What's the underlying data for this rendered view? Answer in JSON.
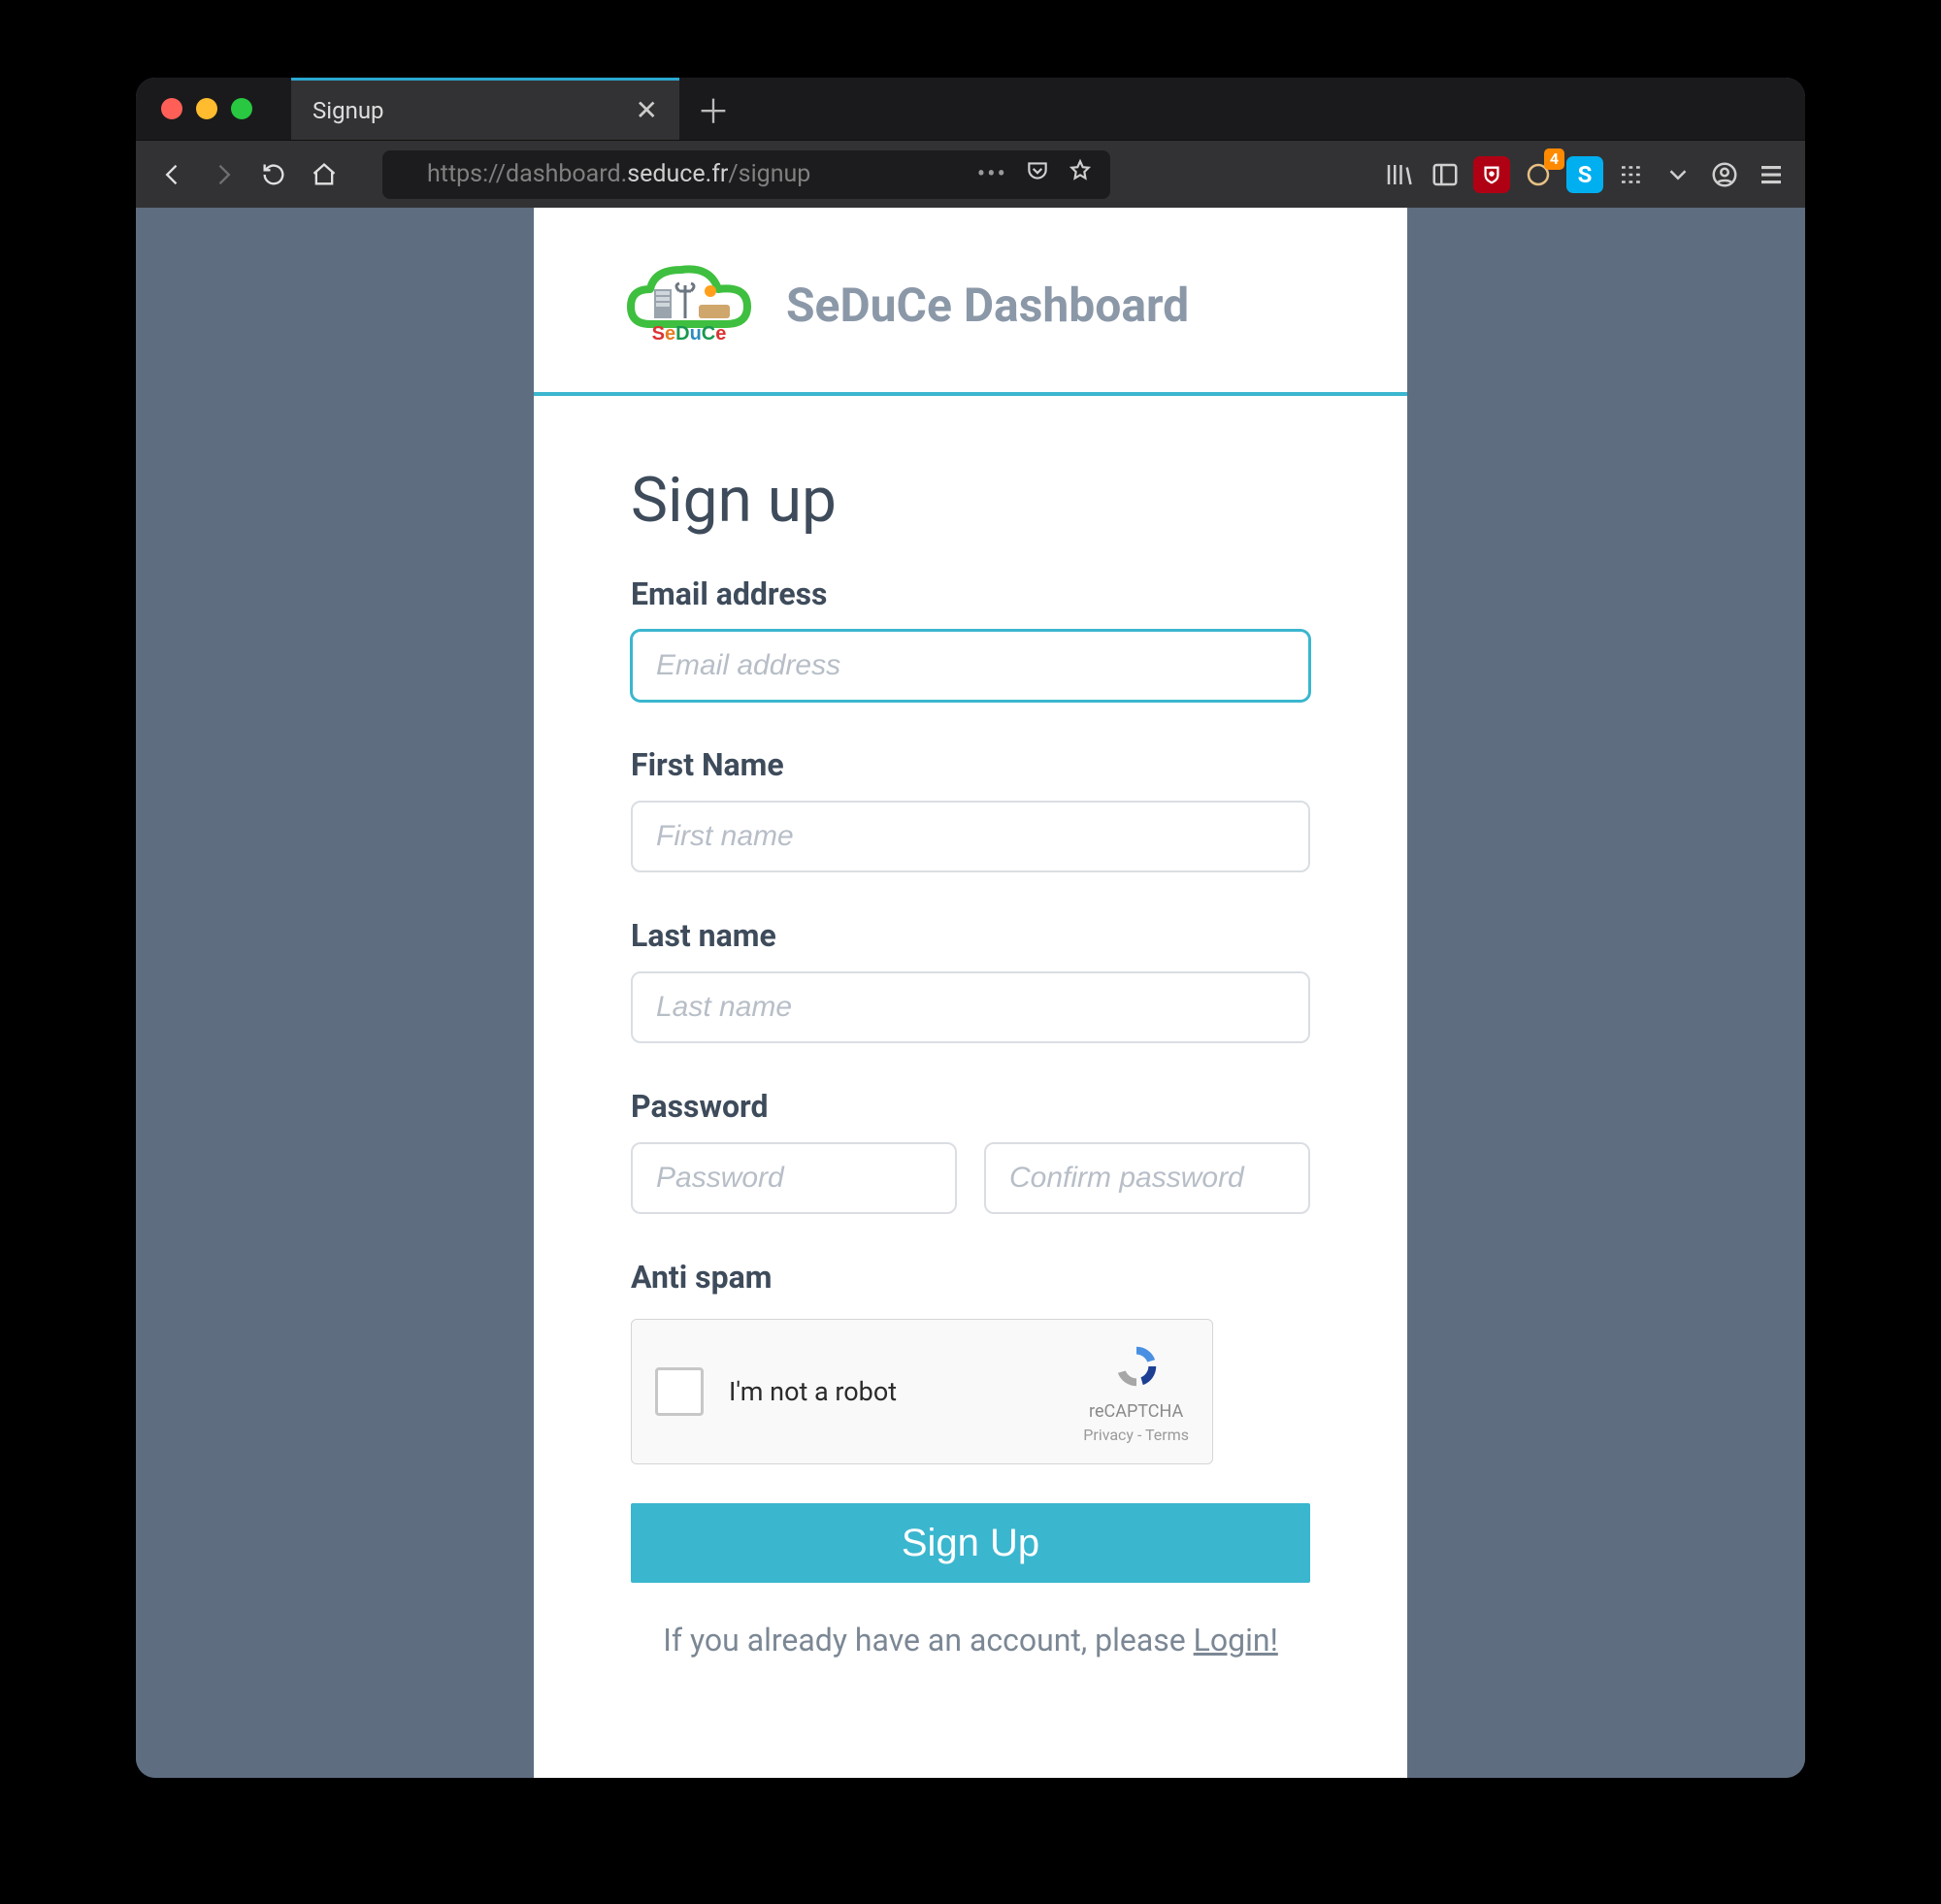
{
  "browser": {
    "tab_title": "Signup",
    "url_display_prefix": "https://dashboard.",
    "url_display_domain": "seduce.fr",
    "url_display_suffix": "/signup",
    "badge_count": "4",
    "skype_letter": "S"
  },
  "header": {
    "brand": "SeDuCe Dashboard",
    "logo_text": "SeDuCe"
  },
  "form": {
    "title": "Sign up",
    "email_label": "Email address",
    "email_placeholder": "Email address",
    "firstname_label": "First Name",
    "firstname_placeholder": "First name",
    "lastname_label": "Last name",
    "lastname_placeholder": "Last name",
    "password_label": "Password",
    "password_placeholder": "Password",
    "confirm_placeholder": "Confirm password",
    "antispam_label": "Anti spam",
    "submit_label": "Sign Up",
    "login_prefix": "If you already have an account, please ",
    "login_link": "Login!"
  },
  "captcha": {
    "text": "I'm not a robot",
    "brand": "reCAPTCHA",
    "legal": "Privacy - Terms"
  }
}
